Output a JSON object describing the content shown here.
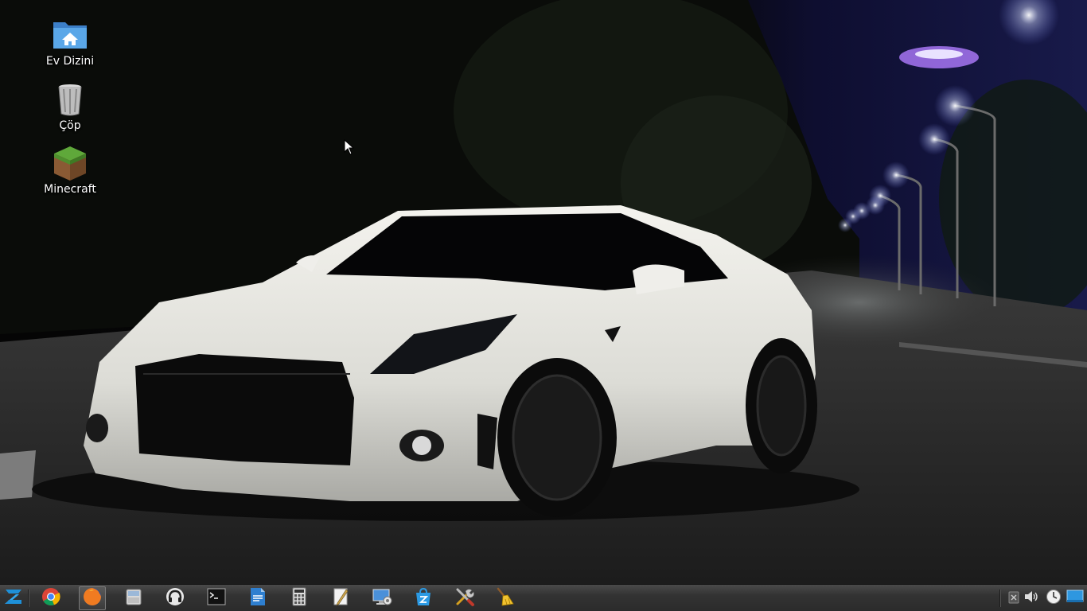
{
  "desktop": {
    "icons": [
      {
        "label": "Ev Dizini",
        "icon": "home-folder-icon"
      },
      {
        "label": "Çöp",
        "icon": "trash-icon"
      },
      {
        "label": "Minecraft",
        "icon": "minecraft-grass-block-icon"
      }
    ],
    "wallpaper": "white sports car on a night road with street lights"
  },
  "taskbar": {
    "start": {
      "icon": "zorin-menu-icon"
    },
    "apps": [
      {
        "icon": "chrome-icon"
      },
      {
        "icon": "firefox-icon",
        "active": true
      },
      {
        "icon": "file-manager-icon"
      },
      {
        "icon": "music-player-icon"
      },
      {
        "icon": "terminal-icon"
      },
      {
        "icon": "document-editor-icon"
      },
      {
        "icon": "calculator-icon"
      },
      {
        "icon": "text-editor-icon"
      },
      {
        "icon": "remote-desktop-icon"
      },
      {
        "icon": "software-store-icon"
      },
      {
        "icon": "system-tools-icon"
      },
      {
        "icon": "cleaner-icon"
      }
    ],
    "tray": [
      {
        "icon": "network-disconnected-icon"
      },
      {
        "icon": "volume-icon"
      },
      {
        "icon": "clock-icon"
      },
      {
        "icon": "show-desktop-icon"
      }
    ]
  },
  "colors": {
    "taskbar_bg": "#333333",
    "accent_blue": "#1e90d8"
  }
}
